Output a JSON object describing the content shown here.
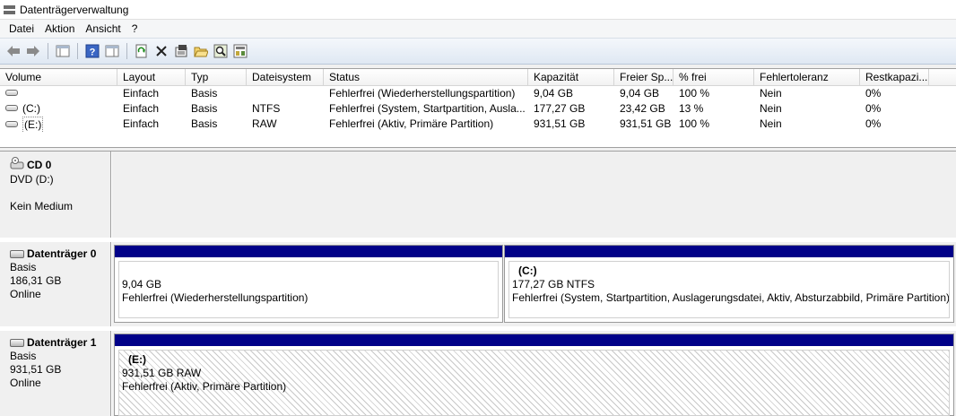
{
  "window": {
    "title": "Datenträgerverwaltung"
  },
  "menu": [
    "Datei",
    "Aktion",
    "Ansicht",
    "?"
  ],
  "toolbar": {
    "icons": [
      "back-arrow-icon",
      "forward-arrow-icon",
      "console-tree-icon",
      "help-icon",
      "properties-view-icon",
      "refresh-icon",
      "delete-icon",
      "properties-icon",
      "open-folder-icon",
      "search-icon",
      "export-icon"
    ]
  },
  "volumes": {
    "columns": [
      "Volume",
      "Layout",
      "Typ",
      "Dateisystem",
      "Status",
      "Kapazität",
      "Freier Sp...",
      "% frei",
      "Fehlertoleranz",
      "Restkapazi..."
    ],
    "rows": [
      {
        "volume": "",
        "layout": "Einfach",
        "typ": "Basis",
        "fs": "",
        "status": "Fehlerfrei (Wiederherstellungspartition)",
        "kapazitaet": "9,04 GB",
        "frei": "9,04 GB",
        "pct": "100 %",
        "fehlertoleranz": "Nein",
        "rest": "0%"
      },
      {
        "volume": "(C:)",
        "layout": "Einfach",
        "typ": "Basis",
        "fs": "NTFS",
        "status": "Fehlerfrei (System, Startpartition, Ausla...",
        "kapazitaet": "177,27 GB",
        "frei": "23,42 GB",
        "pct": "13 %",
        "fehlertoleranz": "Nein",
        "rest": "0%"
      },
      {
        "volume": "(E:)",
        "layout": "Einfach",
        "typ": "Basis",
        "fs": "RAW",
        "status": "Fehlerfrei (Aktiv, Primäre Partition)",
        "kapazitaet": "931,51 GB",
        "frei": "931,51 GB",
        "pct": "100 %",
        "fehlertoleranz": "Nein",
        "rest": "0%"
      }
    ]
  },
  "disks": {
    "cd0": {
      "name": "CD 0",
      "line1": "DVD (D:)",
      "line2": "Kein Medium"
    },
    "disk0": {
      "name": "Datenträger 0",
      "type": "Basis",
      "size": "186,31 GB",
      "status": "Online",
      "partitions": [
        {
          "name": "",
          "size": "9,04 GB",
          "status": "Fehlerfrei (Wiederherstellungspartition)"
        },
        {
          "name": "(C:)",
          "size": "177,27 GB NTFS",
          "status": "Fehlerfrei (System, Startpartition, Auslagerungsdatei, Aktiv, Absturzabbild, Primäre Partition)"
        }
      ]
    },
    "disk1": {
      "name": "Datenträger 1",
      "type": "Basis",
      "size": "931,51 GB",
      "status": "Online",
      "partitions": [
        {
          "name": "(E:)",
          "size": "931,51 GB RAW",
          "status": "Fehlerfrei (Aktiv, Primäre Partition)"
        }
      ]
    }
  },
  "colors": {
    "partition_bar": "#000088",
    "toolbar_bg": "#dfe8f3"
  }
}
